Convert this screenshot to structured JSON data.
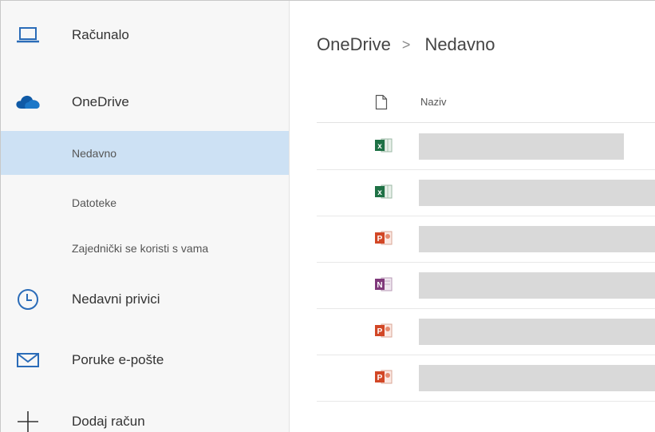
{
  "sidebar": {
    "items": [
      {
        "label": "Računalo",
        "icon": "laptop-icon"
      },
      {
        "label": "OneDrive",
        "icon": "onedrive-cloud-icon"
      },
      {
        "label": "Nedavno",
        "selected": true
      },
      {
        "label": "Datoteke"
      },
      {
        "label": "Zajednički se koristi s vama"
      },
      {
        "label": "Nedavni privici",
        "icon": "clock-icon"
      },
      {
        "label": "Poruke e-pošte",
        "icon": "mail-icon"
      },
      {
        "label": "Dodaj račun",
        "icon": "plus-icon"
      }
    ]
  },
  "main": {
    "breadcrumb": {
      "root": "OneDrive",
      "separator": ">",
      "current": "Nedavno"
    },
    "header": {
      "name_label": "Naziv",
      "icon": "file-icon"
    },
    "files": [
      {
        "type": "excel",
        "icon": "excel-file-icon"
      },
      {
        "type": "excel",
        "icon": "excel-file-icon"
      },
      {
        "type": "powerpoint",
        "icon": "powerpoint-file-icon"
      },
      {
        "type": "onenote",
        "icon": "onenote-file-icon"
      },
      {
        "type": "powerpoint",
        "icon": "powerpoint-file-icon"
      },
      {
        "type": "powerpoint",
        "icon": "powerpoint-file-icon"
      }
    ]
  },
  "colors": {
    "selected_bg": "#cde1f4",
    "accent": "#2b6cb8",
    "excel": "#1e7145",
    "powerpoint": "#d24726",
    "onenote": "#80397b",
    "placeholder": "#d9d9d9"
  }
}
